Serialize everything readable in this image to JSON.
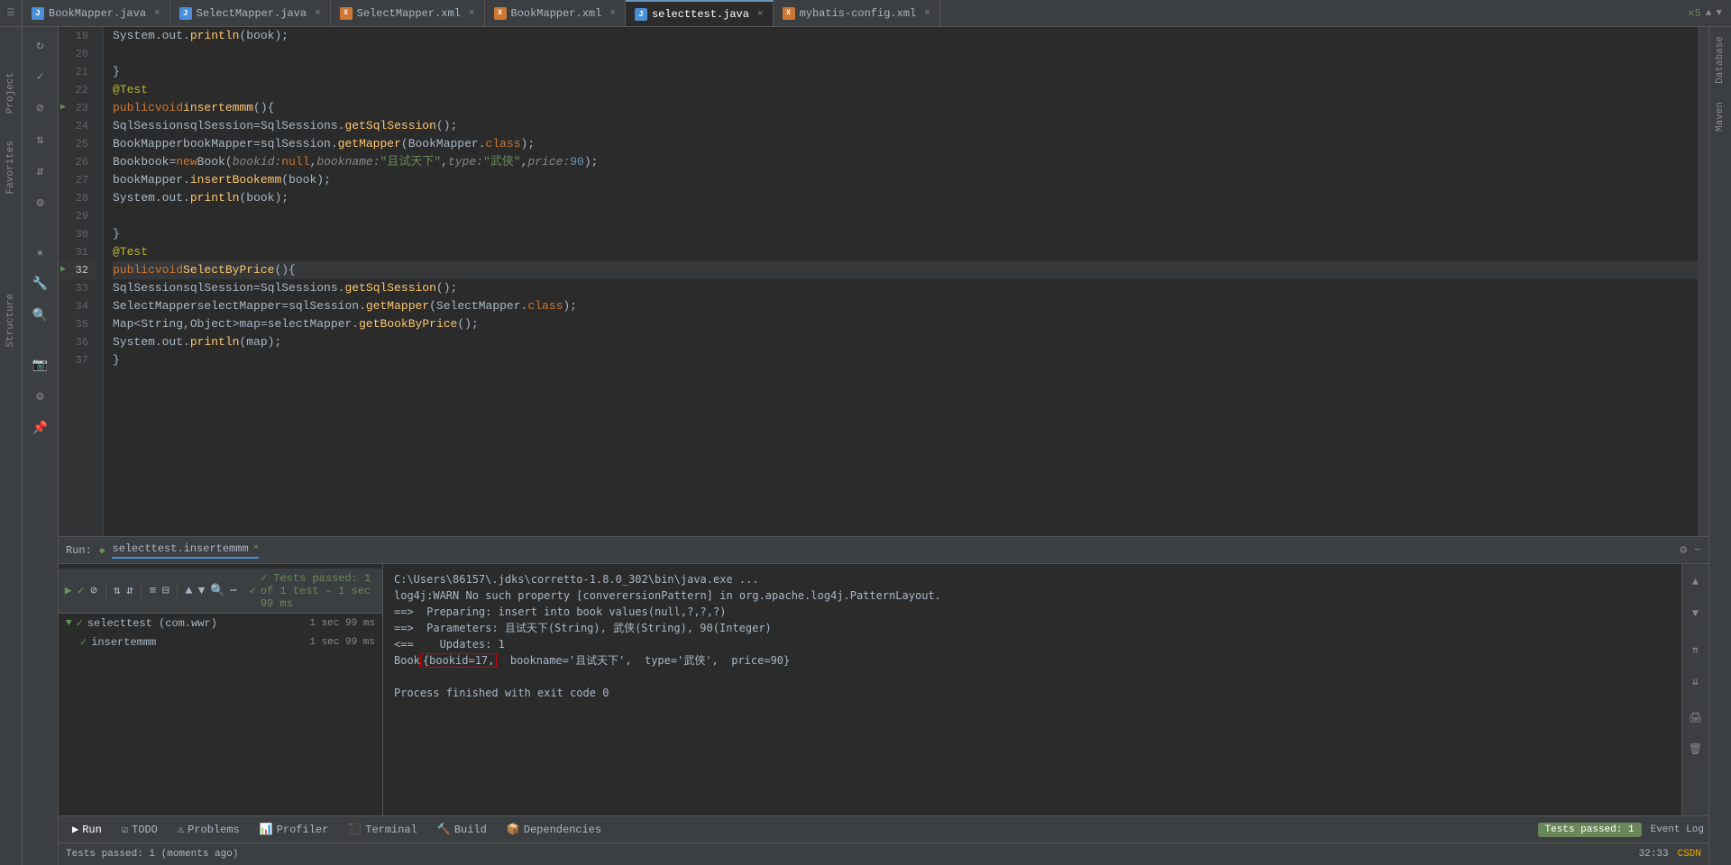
{
  "tabs": [
    {
      "id": "bookMapper-java",
      "label": "BookMapper.java",
      "type": "java",
      "active": false
    },
    {
      "id": "selectMapper-java",
      "label": "SelectMapper.java",
      "type": "java",
      "active": false
    },
    {
      "id": "selectMapper-xml",
      "label": "SelectMapper.xml",
      "type": "xml",
      "active": false
    },
    {
      "id": "bookMapper-xml",
      "label": "BookMapper.xml",
      "type": "xml",
      "active": false
    },
    {
      "id": "selecttest-java",
      "label": "selecttest.java",
      "type": "java-active",
      "active": true
    },
    {
      "id": "mybatis-config-xml",
      "label": "mybatis-config.xml",
      "type": "xml",
      "active": false
    }
  ],
  "code_lines": [
    {
      "num": 19,
      "content": "    System.out.println(book);",
      "type": "normal"
    },
    {
      "num": 20,
      "content": "",
      "type": "normal"
    },
    {
      "num": 21,
      "content": "    }",
      "type": "normal"
    },
    {
      "num": 22,
      "content": "    @Test",
      "type": "annotation"
    },
    {
      "num": 23,
      "content": "    public void insertemmm(){",
      "type": "normal",
      "has_gutter": "run"
    },
    {
      "num": 24,
      "content": "        SqlSession sqlSession =SqlSessions.getSqlSession();",
      "type": "normal"
    },
    {
      "num": 25,
      "content": "        BookMapper bookMapper = sqlSession.getMapper(BookMapper.class);",
      "type": "normal"
    },
    {
      "num": 26,
      "content": "        Book book = new Book( bookid: null, bookname: \"且试天下\", type: \"武侠\", price: 90);",
      "type": "normal"
    },
    {
      "num": 27,
      "content": "        bookMapper.insertBookemm(book);",
      "type": "normal"
    },
    {
      "num": 28,
      "content": "        System.out.println(book);",
      "type": "normal"
    },
    {
      "num": 29,
      "content": "",
      "type": "normal"
    },
    {
      "num": 30,
      "content": "    }",
      "type": "normal"
    },
    {
      "num": 31,
      "content": "    @Test",
      "type": "annotation"
    },
    {
      "num": 32,
      "content": "    public void SelectByPrice(){",
      "type": "highlighted",
      "has_gutter": "run"
    },
    {
      "num": 33,
      "content": "        SqlSession sqlSession =SqlSessions.getSqlSession();",
      "type": "normal"
    },
    {
      "num": 34,
      "content": "        SelectMapper selectMapper = sqlSession.getMapper(SelectMapper.class);",
      "type": "normal"
    },
    {
      "num": 35,
      "content": "        Map<String,Object> map = selectMapper.getBookByPrice();",
      "type": "normal"
    },
    {
      "num": 36,
      "content": "        System.out.println(map);",
      "type": "normal"
    },
    {
      "num": 37,
      "content": "    }",
      "type": "normal"
    }
  ],
  "run_panel": {
    "label": "Run:",
    "tab_name": "selecttest.insertemmm",
    "status_text": "✓  Tests passed: 1 of 1 test – 1 sec 99 ms",
    "test_tree": [
      {
        "name": "selecttest (com.wwr)",
        "time": "1 sec 99 ms",
        "status": "pass",
        "indent": 0
      },
      {
        "name": "insertemmm",
        "time": "1 sec 99 ms",
        "status": "pass",
        "indent": 1
      }
    ],
    "console_lines": [
      "C:\\Users\\86157\\.jdks\\corretto-1.8.0_302\\bin\\java.exe ...",
      "log4j:WARN No such property [converersionPattern] in org.apache.log4j.PatternLayout.",
      "==>  Preparing: insert into book values(null,?,?,?)",
      "==>  Parameters: 且试天下(String), 武侠(String), 90(Integer)",
      "<==    Updates: 1",
      "Book{bookid=17,  bookname='且试天下',  type='武侠',  price=90}",
      "",
      "Process finished with exit code 0"
    ]
  },
  "bottom_tabs": [
    {
      "label": "Run",
      "icon": "▶",
      "active": true
    },
    {
      "label": "TODO",
      "icon": "☑",
      "active": false
    },
    {
      "label": "Problems",
      "icon": "⚠",
      "active": false
    },
    {
      "label": "Profiler",
      "icon": "📊",
      "active": false
    },
    {
      "label": "Terminal",
      "icon": "⬛",
      "active": false
    },
    {
      "label": "Build",
      "icon": "🔨",
      "active": false
    },
    {
      "label": "Dependencies",
      "icon": "📦",
      "active": false
    }
  ],
  "status_bar": {
    "left_text": "Tests passed: 1 (moments ago)",
    "right_text": "32:33",
    "event_log": "Event Log",
    "csdn": "CSDN"
  },
  "right_panel_labels": [
    "Database",
    "Maven"
  ],
  "left_panel_labels": [
    "Project",
    "Favorites",
    "Structure"
  ],
  "toolbar_right_top": "✕5",
  "tests_passed_badge": "Tests passed: 1"
}
